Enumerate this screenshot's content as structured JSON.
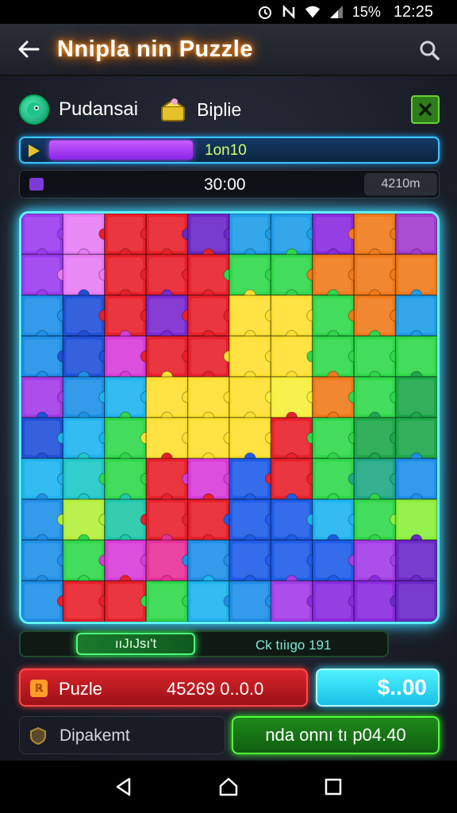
{
  "status_bar": {
    "battery": "15%",
    "time": "12:25",
    "icons": [
      "alarm-icon",
      "nfc-icon",
      "wifi-icon",
      "signal-icon"
    ]
  },
  "app_bar": {
    "title": "Nnipla nin Puzzle",
    "back_icon": "back-arrow-icon",
    "search_icon": "search-icon"
  },
  "players": {
    "player_name": "Pudansai",
    "opponent_name": "Biplie",
    "close_icon": "close-icon"
  },
  "progress": {
    "label": "1on10",
    "fill_fraction": 0.37,
    "fill_color": "#b14cff"
  },
  "score": {
    "value": "30:00",
    "timer": "4210m"
  },
  "board": {
    "rows": 10,
    "cols": 10,
    "colors": [
      [
        "#9b3bf0",
        "#e77cf5",
        "#e8202a",
        "#e8202a",
        "#6a28c8",
        "#1e9ce8",
        "#1e9ce8",
        "#8a2ae0",
        "#f07a1a",
        "#a23ad0"
      ],
      [
        "#9b3bf0",
        "#e77cf5",
        "#e8202a",
        "#e8202a",
        "#e8202a",
        "#2fd84a",
        "#2fd84a",
        "#f07a1a",
        "#f07a1a",
        "#f07a1a"
      ],
      [
        "#1e8fe8",
        "#2050d8",
        "#e8202a",
        "#7a28d0",
        "#e8202a",
        "#ffe030",
        "#ffe030",
        "#2fd84a",
        "#f07a1a",
        "#1e9ce8"
      ],
      [
        "#1e8fe8",
        "#2050d8",
        "#d83cd8",
        "#e8202a",
        "#e8202a",
        "#ffe030",
        "#ffe030",
        "#2fd84a",
        "#2fd84a",
        "#2fd84a"
      ],
      [
        "#a33ce8",
        "#1e8fe8",
        "#1eb4f0",
        "#ffe030",
        "#ffe030",
        "#ffe030",
        "#f7f03a",
        "#f07a1a",
        "#2fd84a",
        "#1ea84a"
      ],
      [
        "#2050d8",
        "#1eb4f0",
        "#2fd84a",
        "#ffe030",
        "#ffe030",
        "#ffe030",
        "#e8202a",
        "#2fd84a",
        "#1ea84a",
        "#1ea84a"
      ],
      [
        "#1eb4f0",
        "#1ec8c8",
        "#2fd84a",
        "#e8202a",
        "#d83cd8",
        "#1e5ce8",
        "#e8202a",
        "#2fd84a",
        "#1ea884",
        "#1e8fe8"
      ],
      [
        "#1e8fe8",
        "#b4f03a",
        "#1ec8a8",
        "#e8202a",
        "#e8202a",
        "#1e5ce8",
        "#1e5ce8",
        "#1eb4f0",
        "#2fd84a",
        "#8af03a"
      ],
      [
        "#1e8fe8",
        "#2fd84a",
        "#d83cd8",
        "#e8309a",
        "#1e8fe8",
        "#1e5ce8",
        "#1e5ce8",
        "#1e5ce8",
        "#a33ce8",
        "#6a28c8"
      ],
      [
        "#1e8fe8",
        "#e8202a",
        "#e8202a",
        "#2fd84a",
        "#1eb4f0",
        "#1e8fe8",
        "#a33ce8",
        "#8a2ae0",
        "#8a2ae0",
        "#6a28c8"
      ]
    ]
  },
  "hint_bar": {
    "button_label": "ııJıJsı't",
    "text": "Ck tıiıgo 191"
  },
  "puzzle_panel": {
    "label": "Puzle",
    "value": "45269 0..0.0",
    "icon_text": "ℝ"
  },
  "price_button": {
    "label": "$..00"
  },
  "dialog_panel": {
    "label": "Dipakemt",
    "icon": "shield-icon"
  },
  "go_button": {
    "label": "nda onnı tı p04.40"
  },
  "nav_bar": {
    "icons": [
      "back-triangle-icon",
      "home-icon",
      "recents-icon"
    ]
  }
}
